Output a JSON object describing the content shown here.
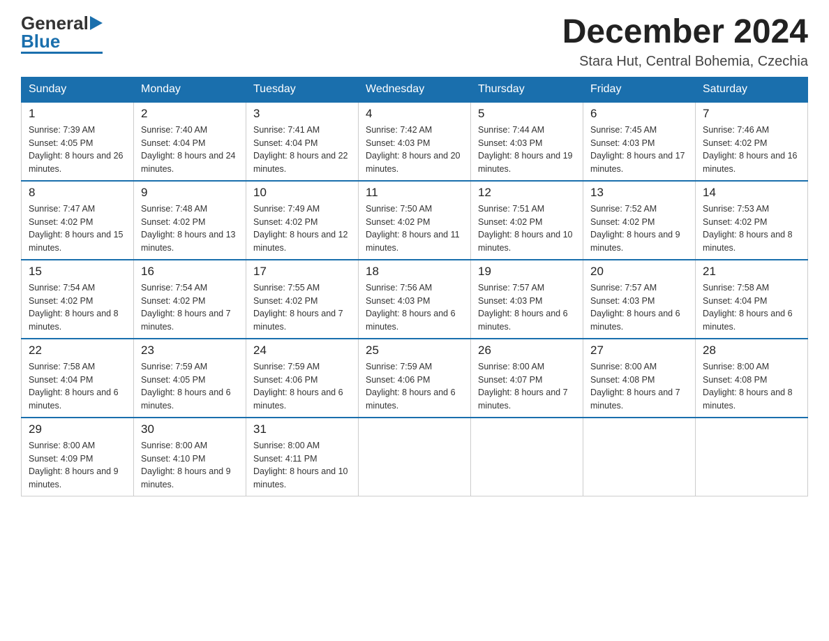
{
  "header": {
    "logo_general": "General",
    "logo_blue": "Blue",
    "month_title": "December 2024",
    "location": "Stara Hut, Central Bohemia, Czechia"
  },
  "days_of_week": [
    "Sunday",
    "Monday",
    "Tuesday",
    "Wednesday",
    "Thursday",
    "Friday",
    "Saturday"
  ],
  "weeks": [
    [
      {
        "day": "1",
        "sunrise": "Sunrise: 7:39 AM",
        "sunset": "Sunset: 4:05 PM",
        "daylight": "Daylight: 8 hours and 26 minutes."
      },
      {
        "day": "2",
        "sunrise": "Sunrise: 7:40 AM",
        "sunset": "Sunset: 4:04 PM",
        "daylight": "Daylight: 8 hours and 24 minutes."
      },
      {
        "day": "3",
        "sunrise": "Sunrise: 7:41 AM",
        "sunset": "Sunset: 4:04 PM",
        "daylight": "Daylight: 8 hours and 22 minutes."
      },
      {
        "day": "4",
        "sunrise": "Sunrise: 7:42 AM",
        "sunset": "Sunset: 4:03 PM",
        "daylight": "Daylight: 8 hours and 20 minutes."
      },
      {
        "day": "5",
        "sunrise": "Sunrise: 7:44 AM",
        "sunset": "Sunset: 4:03 PM",
        "daylight": "Daylight: 8 hours and 19 minutes."
      },
      {
        "day": "6",
        "sunrise": "Sunrise: 7:45 AM",
        "sunset": "Sunset: 4:03 PM",
        "daylight": "Daylight: 8 hours and 17 minutes."
      },
      {
        "day": "7",
        "sunrise": "Sunrise: 7:46 AM",
        "sunset": "Sunset: 4:02 PM",
        "daylight": "Daylight: 8 hours and 16 minutes."
      }
    ],
    [
      {
        "day": "8",
        "sunrise": "Sunrise: 7:47 AM",
        "sunset": "Sunset: 4:02 PM",
        "daylight": "Daylight: 8 hours and 15 minutes."
      },
      {
        "day": "9",
        "sunrise": "Sunrise: 7:48 AM",
        "sunset": "Sunset: 4:02 PM",
        "daylight": "Daylight: 8 hours and 13 minutes."
      },
      {
        "day": "10",
        "sunrise": "Sunrise: 7:49 AM",
        "sunset": "Sunset: 4:02 PM",
        "daylight": "Daylight: 8 hours and 12 minutes."
      },
      {
        "day": "11",
        "sunrise": "Sunrise: 7:50 AM",
        "sunset": "Sunset: 4:02 PM",
        "daylight": "Daylight: 8 hours and 11 minutes."
      },
      {
        "day": "12",
        "sunrise": "Sunrise: 7:51 AM",
        "sunset": "Sunset: 4:02 PM",
        "daylight": "Daylight: 8 hours and 10 minutes."
      },
      {
        "day": "13",
        "sunrise": "Sunrise: 7:52 AM",
        "sunset": "Sunset: 4:02 PM",
        "daylight": "Daylight: 8 hours and 9 minutes."
      },
      {
        "day": "14",
        "sunrise": "Sunrise: 7:53 AM",
        "sunset": "Sunset: 4:02 PM",
        "daylight": "Daylight: 8 hours and 8 minutes."
      }
    ],
    [
      {
        "day": "15",
        "sunrise": "Sunrise: 7:54 AM",
        "sunset": "Sunset: 4:02 PM",
        "daylight": "Daylight: 8 hours and 8 minutes."
      },
      {
        "day": "16",
        "sunrise": "Sunrise: 7:54 AM",
        "sunset": "Sunset: 4:02 PM",
        "daylight": "Daylight: 8 hours and 7 minutes."
      },
      {
        "day": "17",
        "sunrise": "Sunrise: 7:55 AM",
        "sunset": "Sunset: 4:02 PM",
        "daylight": "Daylight: 8 hours and 7 minutes."
      },
      {
        "day": "18",
        "sunrise": "Sunrise: 7:56 AM",
        "sunset": "Sunset: 4:03 PM",
        "daylight": "Daylight: 8 hours and 6 minutes."
      },
      {
        "day": "19",
        "sunrise": "Sunrise: 7:57 AM",
        "sunset": "Sunset: 4:03 PM",
        "daylight": "Daylight: 8 hours and 6 minutes."
      },
      {
        "day": "20",
        "sunrise": "Sunrise: 7:57 AM",
        "sunset": "Sunset: 4:03 PM",
        "daylight": "Daylight: 8 hours and 6 minutes."
      },
      {
        "day": "21",
        "sunrise": "Sunrise: 7:58 AM",
        "sunset": "Sunset: 4:04 PM",
        "daylight": "Daylight: 8 hours and 6 minutes."
      }
    ],
    [
      {
        "day": "22",
        "sunrise": "Sunrise: 7:58 AM",
        "sunset": "Sunset: 4:04 PM",
        "daylight": "Daylight: 8 hours and 6 minutes."
      },
      {
        "day": "23",
        "sunrise": "Sunrise: 7:59 AM",
        "sunset": "Sunset: 4:05 PM",
        "daylight": "Daylight: 8 hours and 6 minutes."
      },
      {
        "day": "24",
        "sunrise": "Sunrise: 7:59 AM",
        "sunset": "Sunset: 4:06 PM",
        "daylight": "Daylight: 8 hours and 6 minutes."
      },
      {
        "day": "25",
        "sunrise": "Sunrise: 7:59 AM",
        "sunset": "Sunset: 4:06 PM",
        "daylight": "Daylight: 8 hours and 6 minutes."
      },
      {
        "day": "26",
        "sunrise": "Sunrise: 8:00 AM",
        "sunset": "Sunset: 4:07 PM",
        "daylight": "Daylight: 8 hours and 7 minutes."
      },
      {
        "day": "27",
        "sunrise": "Sunrise: 8:00 AM",
        "sunset": "Sunset: 4:08 PM",
        "daylight": "Daylight: 8 hours and 7 minutes."
      },
      {
        "day": "28",
        "sunrise": "Sunrise: 8:00 AM",
        "sunset": "Sunset: 4:08 PM",
        "daylight": "Daylight: 8 hours and 8 minutes."
      }
    ],
    [
      {
        "day": "29",
        "sunrise": "Sunrise: 8:00 AM",
        "sunset": "Sunset: 4:09 PM",
        "daylight": "Daylight: 8 hours and 9 minutes."
      },
      {
        "day": "30",
        "sunrise": "Sunrise: 8:00 AM",
        "sunset": "Sunset: 4:10 PM",
        "daylight": "Daylight: 8 hours and 9 minutes."
      },
      {
        "day": "31",
        "sunrise": "Sunrise: 8:00 AM",
        "sunset": "Sunset: 4:11 PM",
        "daylight": "Daylight: 8 hours and 10 minutes."
      },
      null,
      null,
      null,
      null
    ]
  ]
}
